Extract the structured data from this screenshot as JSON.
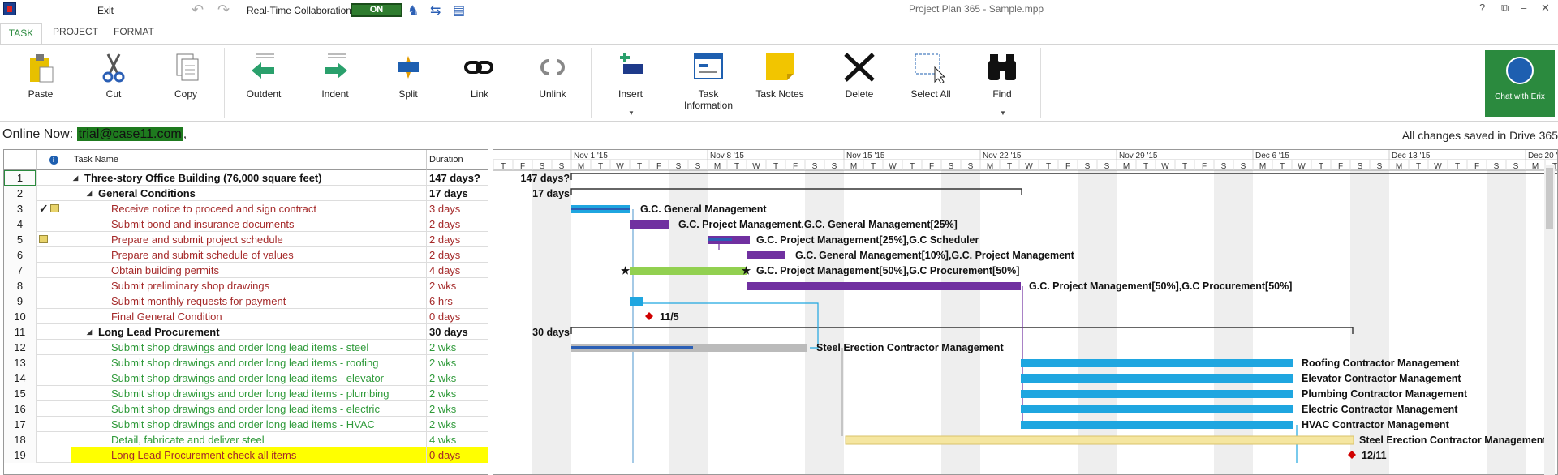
{
  "titlebar": {
    "exit_label": "Exit",
    "collab_label": "Real-Time Collaboration",
    "collab_state": "ON",
    "window_title": "Project Plan 365 - Sample.mpp",
    "help": "?",
    "restore": "⧉",
    "minimize": "–",
    "maximize": "□",
    "close": "✕"
  },
  "tabs": [
    "TASK",
    "PROJECT",
    "FORMAT"
  ],
  "ribbon": {
    "paste": "Paste",
    "cut": "Cut",
    "copy": "Copy",
    "outdent": "Outdent",
    "indent": "Indent",
    "split": "Split",
    "link": "Link",
    "unlink": "Unlink",
    "insert": "Insert",
    "task_info_1": "Task",
    "task_info_2": "Information",
    "task_notes": "Task Notes",
    "delete": "Delete",
    "select_all": "Select All",
    "find": "Find"
  },
  "chat": {
    "label": "Chat with Erix"
  },
  "online": {
    "prefix": "Online Now: ",
    "email": "trial@case11.com",
    "suffix": ","
  },
  "saved": "All changes saved in Drive 365",
  "grid": {
    "headers": {
      "name": "Task Name",
      "duration": "Duration"
    },
    "rows": [
      {
        "id": "1",
        "name": "Three-story Office Building (76,000 square feet)",
        "dur": "147 days?",
        "level": 0,
        "style": "summ",
        "ind": ""
      },
      {
        "id": "2",
        "name": "General Conditions",
        "dur": "17 days",
        "level": 1,
        "style": "summ",
        "ind": ""
      },
      {
        "id": "3",
        "name": "Receive notice to proceed and sign contract",
        "dur": "3 days",
        "level": 2,
        "style": "dred",
        "ind": "check-note"
      },
      {
        "id": "4",
        "name": "Submit bond and insurance documents",
        "dur": "2 days",
        "level": 2,
        "style": "dred",
        "ind": ""
      },
      {
        "id": "5",
        "name": "Prepare and submit project schedule",
        "dur": "2 days",
        "level": 2,
        "style": "dred",
        "ind": "note"
      },
      {
        "id": "6",
        "name": "Prepare and submit schedule of values",
        "dur": "2 days",
        "level": 2,
        "style": "dred",
        "ind": ""
      },
      {
        "id": "7",
        "name": "Obtain building permits",
        "dur": "4 days",
        "level": 2,
        "style": "dred",
        "ind": ""
      },
      {
        "id": "8",
        "name": "Submit preliminary shop drawings",
        "dur": "2 wks",
        "level": 2,
        "style": "dred",
        "ind": ""
      },
      {
        "id": "9",
        "name": "Submit monthly requests for payment",
        "dur": "6 hrs",
        "level": 2,
        "style": "dred",
        "ind": ""
      },
      {
        "id": "10",
        "name": "Final General Condition",
        "dur": "0 days",
        "level": 2,
        "style": "dred",
        "ind": ""
      },
      {
        "id": "11",
        "name": "Long Lead Procurement",
        "dur": "30 days",
        "level": 1,
        "style": "summ",
        "ind": ""
      },
      {
        "id": "12",
        "name": "Submit shop drawings and order long lead items - steel",
        "dur": "2 wks",
        "level": 2,
        "style": "dgreen",
        "ind": ""
      },
      {
        "id": "13",
        "name": "Submit shop drawings and order long lead items - roofing",
        "dur": "2 wks",
        "level": 2,
        "style": "dgreen",
        "ind": ""
      },
      {
        "id": "14",
        "name": "Submit shop drawings and order long lead items - elevator",
        "dur": "2 wks",
        "level": 2,
        "style": "dgreen",
        "ind": ""
      },
      {
        "id": "15",
        "name": "Submit shop drawings and order long lead items - plumbing",
        "dur": "2 wks",
        "level": 2,
        "style": "dgreen",
        "ind": ""
      },
      {
        "id": "16",
        "name": "Submit shop drawings and order long lead items - electric",
        "dur": "2 wks",
        "level": 2,
        "style": "dgreen",
        "ind": ""
      },
      {
        "id": "17",
        "name": "Submit shop drawings and order long lead items - HVAC",
        "dur": "2 wks",
        "level": 2,
        "style": "dgreen",
        "ind": ""
      },
      {
        "id": "18",
        "name": "Detail, fabricate and deliver steel",
        "dur": "4 wks",
        "level": 2,
        "style": "dgreen",
        "ind": ""
      },
      {
        "id": "19",
        "name": "Long Lead Procurement check all items",
        "dur": "0 days",
        "level": 2,
        "style": "dred hl",
        "ind": ""
      }
    ]
  },
  "gantt": {
    "weeks": [
      "Nov 1 '15",
      "Nov 8 '15",
      "Nov 15 '15",
      "Nov 22 '15",
      "Nov 29 '15",
      "Dec 6 '15",
      "Dec 13 '15",
      "Dec 20 '"
    ],
    "day_letters": [
      "T",
      "F",
      "S",
      "S",
      "M",
      "T",
      "W",
      "T",
      "F",
      "S",
      "S",
      "M",
      "T",
      "W",
      "T",
      "F",
      "S",
      "S",
      "M",
      "T",
      "W",
      "T",
      "F",
      "S",
      "S",
      "M",
      "T",
      "W",
      "T",
      "F",
      "S",
      "S",
      "M",
      "T",
      "W",
      "T",
      "F",
      "S",
      "S",
      "M",
      "T",
      "W",
      "T",
      "F",
      "S",
      "S",
      "M",
      "T",
      "W",
      "T",
      "F",
      "S",
      "S",
      "M",
      "T",
      "W",
      "T",
      "F",
      "S",
      "S",
      "M",
      "T",
      "W",
      "T",
      "F",
      "S",
      "S",
      "M"
    ],
    "labels": {
      "r1": "147 days?",
      "r2": "17 days",
      "r3": "G.C. General Management",
      "r4": "G.C. Project Management,G.C. General Management[25%]",
      "r5": "G.C. Project Management[25%],G.C Scheduler",
      "r6": "G.C. General Management[10%],G.C. Project Management",
      "r7": "G.C. Project Management[50%],G.C Procurement[50%]",
      "r8": "G.C. Project Management[50%],G.C Procurement[50%]",
      "r10": "11/5",
      "r11": "30 days",
      "r12": "Steel Erection Contractor Management",
      "r13": "Roofing Contractor Management",
      "r14": "Elevator Contractor Management",
      "r15": "Plumbing Contractor Management",
      "r16": "Electric Contractor Management",
      "r17": "HVAC Contractor Management",
      "r18": "Steel Erection Contractor Management",
      "r19": "12/11"
    }
  },
  "colors": {
    "accent": "#2b8a3e",
    "bar_blue": "#1fa6e0",
    "bar_purple": "#7030a0",
    "bar_green": "#92d050",
    "milestone": "#d00000"
  }
}
